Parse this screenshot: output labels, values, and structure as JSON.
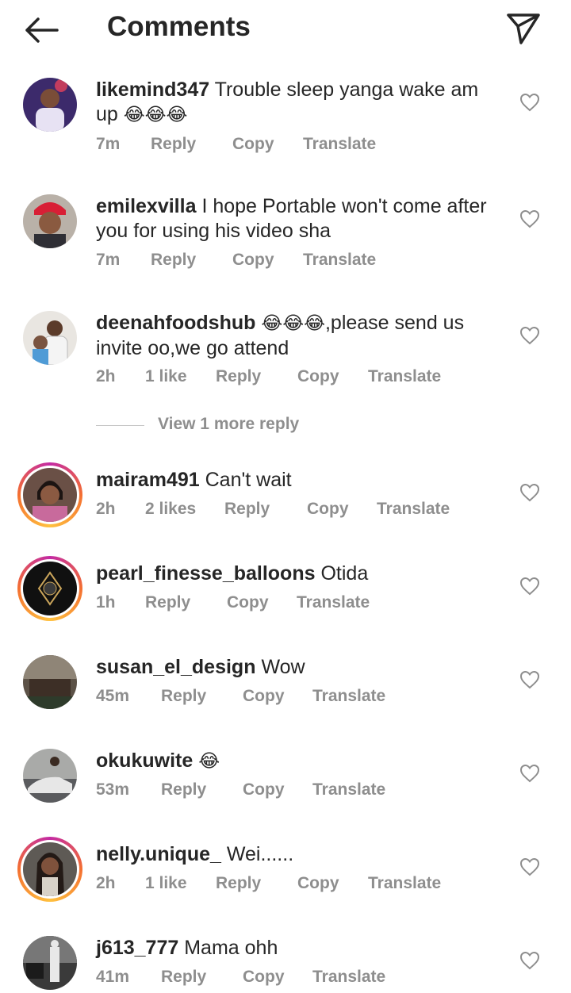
{
  "header": {
    "title": "Comments",
    "back_icon": "arrow-left-icon",
    "share_icon": "paper-plane-icon"
  },
  "actions": {
    "reply": "Reply",
    "copy": "Copy",
    "translate": "Translate"
  },
  "view_more": "View 1 more reply",
  "colors": {
    "text": "#262626",
    "muted": "#8e8e8e",
    "story_ring": "#c32aa3"
  },
  "comments": [
    {
      "username": "likemind347",
      "text": "Trouble sleep yanga wake am up",
      "emoji": "😂😂😂",
      "time": "7m",
      "likes": ""
    },
    {
      "username": "emilexvilla",
      "text": "I hope Portable won't come after you for using his video sha",
      "emoji": "",
      "time": "7m",
      "likes": ""
    },
    {
      "username": "deenahfoodshub",
      "emoji": "😂😂😂",
      "text": ",please send us invite oo,we go attend",
      "time": "2h",
      "likes": "1 like"
    },
    {
      "username": "mairam491",
      "text": "Can't wait",
      "emoji": "",
      "time": "2h",
      "likes": "2 likes"
    },
    {
      "username": "pearl_finesse_balloons",
      "text": "Otida",
      "emoji": "",
      "time": "1h",
      "likes": ""
    },
    {
      "username": "susan_el_design",
      "text": "Wow",
      "emoji": "",
      "time": "45m",
      "likes": ""
    },
    {
      "username": "okukuwite",
      "text": "",
      "emoji": "😂",
      "time": "53m",
      "likes": ""
    },
    {
      "username": "nelly.unique_",
      "text": "Wei......",
      "emoji": "",
      "time": "2h",
      "likes": "1 like"
    },
    {
      "username": "j613_777",
      "text": "Mama ohh",
      "emoji": "",
      "time": "41m",
      "likes": ""
    }
  ]
}
